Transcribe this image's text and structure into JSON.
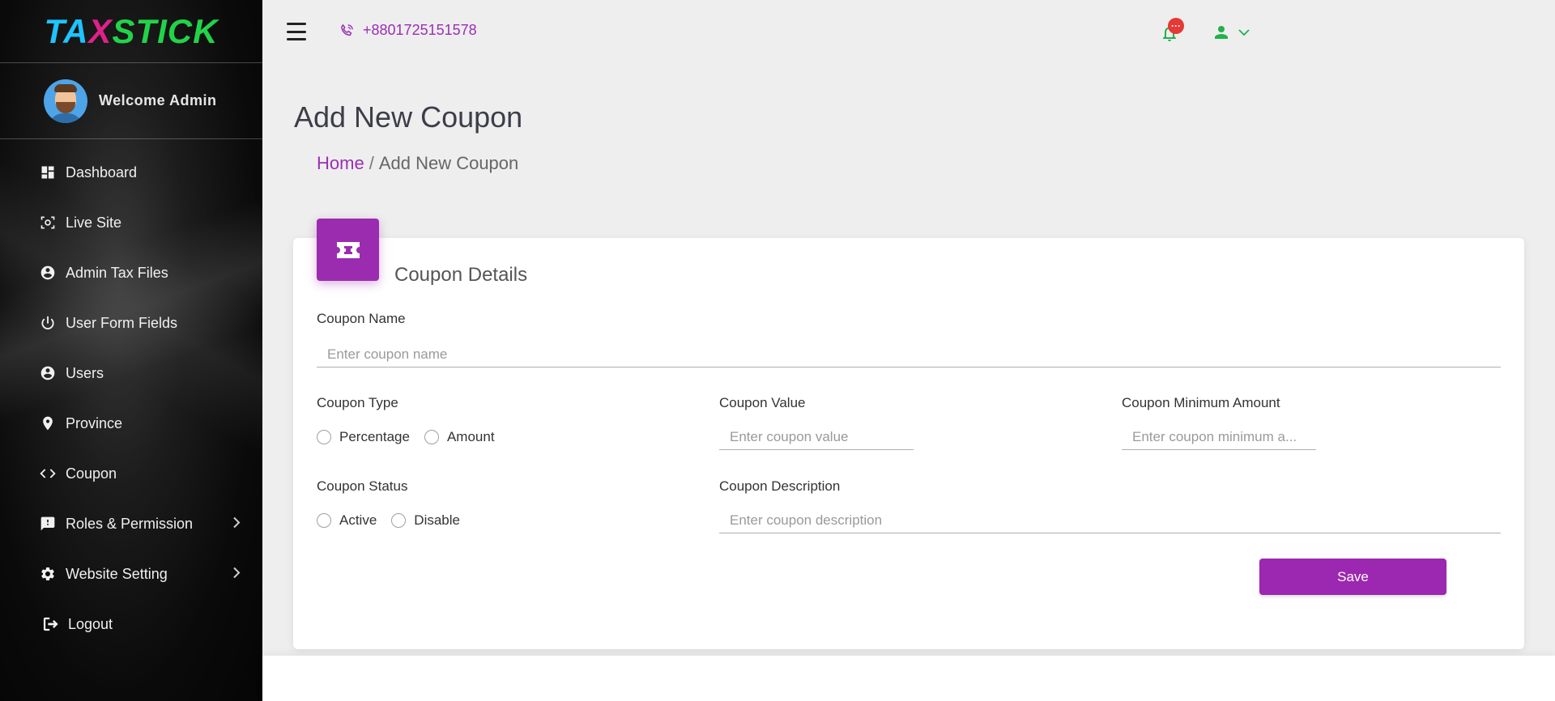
{
  "brand": {
    "logo_text_1": "TA",
    "logo_text_2": "X",
    "logo_text_3": "STICK"
  },
  "sidebar": {
    "welcome": "Welcome Admin",
    "items": [
      {
        "label": "Dashboard",
        "icon": "dashboard-icon"
      },
      {
        "label": "Live Site",
        "icon": "screen-icon"
      },
      {
        "label": "Admin Tax Files",
        "icon": "account-circle-icon"
      },
      {
        "label": "User Form Fields",
        "icon": "power-icon"
      },
      {
        "label": "Users",
        "icon": "account-circle-icon"
      },
      {
        "label": "Province",
        "icon": "location-pin-icon"
      },
      {
        "label": "Coupon",
        "icon": "code-icon"
      },
      {
        "label": "Roles & Permission",
        "icon": "feedback-icon",
        "has_submenu": true
      },
      {
        "label": "Website Setting",
        "icon": "gear-icon",
        "has_submenu": true
      },
      {
        "label": "Logout",
        "icon": "logout-icon"
      }
    ]
  },
  "topbar": {
    "phone": "+8801725151578",
    "notification_badge": "···"
  },
  "page": {
    "title": "Add New Coupon",
    "breadcrumb_home": "Home",
    "breadcrumb_sep": "/",
    "breadcrumb_current": "Add New Coupon"
  },
  "form": {
    "card_title": "Coupon Details",
    "coupon_name_label": "Coupon Name",
    "coupon_name_placeholder": "Enter coupon name",
    "coupon_type_label": "Coupon Type",
    "coupon_type_options": [
      "Percentage",
      "Amount"
    ],
    "coupon_value_label": "Coupon Value",
    "coupon_value_placeholder": "Enter coupon value",
    "coupon_min_label": "Coupon Minimum Amount",
    "coupon_min_placeholder": "Enter coupon minimum a...",
    "coupon_status_label": "Coupon Status",
    "coupon_status_options": [
      "Active",
      "Disable"
    ],
    "coupon_desc_label": "Coupon Description",
    "coupon_desc_placeholder": "Enter coupon description",
    "save_label": "Save"
  },
  "colors": {
    "accent": "#9c27b0",
    "link": "#9b2fb5",
    "bell": "#22b14c",
    "badge": "#e53935",
    "user_icon": "#22b14c"
  }
}
